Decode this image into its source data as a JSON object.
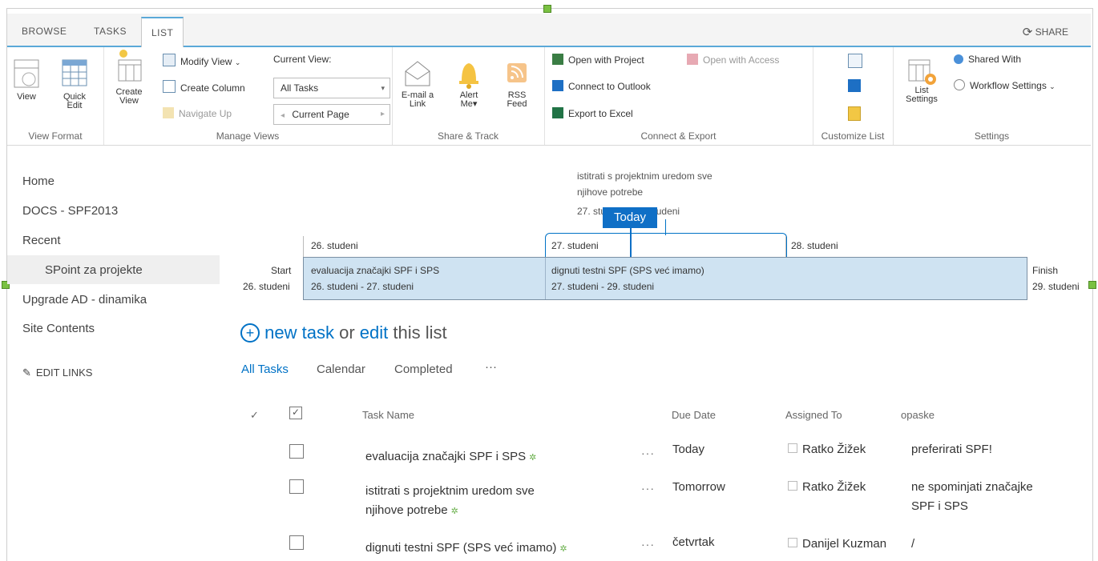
{
  "tabs": [
    "BROWSE",
    "TASKS",
    "LIST"
  ],
  "share_label": "SHARE",
  "ribbon": {
    "view_format": {
      "label": "View Format",
      "view": "View",
      "quick_edit_1": "Quick",
      "quick_edit_2": "Edit"
    },
    "manage_views": {
      "label": "Manage Views",
      "create_view_1": "Create",
      "create_view_2": "View",
      "modify_view": "Modify View",
      "create_column": "Create Column",
      "navigate_up": "Navigate Up",
      "current_view_label": "Current View:",
      "current_view_value": "All Tasks",
      "current_page": "Current Page"
    },
    "share_track": {
      "label": "Share & Track",
      "email_1": "E-mail a",
      "email_2": "Link",
      "alert_1": "Alert",
      "alert_2": "Me",
      "rss_1": "RSS",
      "rss_2": "Feed"
    },
    "connect_export": {
      "label": "Connect & Export",
      "open_project": "Open with Project",
      "open_access": "Open with Access",
      "connect_outlook": "Connect to Outlook",
      "export_excel": "Export to Excel"
    },
    "customize_list": {
      "label": "Customize List"
    },
    "settings": {
      "label": "Settings",
      "list_settings_1": "List",
      "list_settings_2": "Settings",
      "shared_with": "Shared With",
      "workflow_settings": "Workflow Settings"
    }
  },
  "nav": [
    "Home",
    "DOCS - SPF2013",
    "Recent",
    "SPoint za projekte",
    "Upgrade AD - dinamika",
    "Site Contents"
  ],
  "edit_links": "EDIT LINKS",
  "timeline": {
    "callout_line1": "istitrati s projektnim uredom sve",
    "callout_line2": "njihove potrebe",
    "callout_date": "27. studeni - 29. studeni",
    "today": "Today",
    "ticks": [
      "26. studeni",
      "27. studeni",
      "28. studeni"
    ],
    "start_label": "Start",
    "start_date": "26. studeni",
    "finish_label": "Finish",
    "finish_date": "29. studeni",
    "task1_name": "evaluacija značajki SPF i SPS",
    "task1_dates": "26. studeni - 27. studeni",
    "task2_name": "dignuti testni SPF (SPS već imamo)",
    "task2_dates": "27. studeni - 29. studeni"
  },
  "new_task": {
    "new": "new task",
    "or": "or",
    "edit": "edit",
    "rest": "this list"
  },
  "views": [
    "All Tasks",
    "Calendar",
    "Completed",
    "···"
  ],
  "columns": {
    "check": "✓",
    "task_name": "Task Name",
    "due_date": "Due Date",
    "assigned_to": "Assigned To",
    "opaske": "opaske"
  },
  "rows": [
    {
      "task": "evaluacija značajki SPF i SPS",
      "task2": "",
      "due": "Today",
      "assigned": "Ratko Žižek",
      "note": "preferirati SPF!",
      "note2": ""
    },
    {
      "task": "istitrati s projektnim uredom sve",
      "task2": "njihove potrebe",
      "due": "Tomorrow",
      "assigned": "Ratko Žižek",
      "note": "ne spominjati značajke",
      "note2": "SPF i SPS"
    },
    {
      "task": "dignuti testni SPF (SPS već imamo)",
      "task2": "",
      "due": "četvrtak",
      "assigned": "Danijel Kuzman",
      "note": "/",
      "note2": ""
    }
  ]
}
